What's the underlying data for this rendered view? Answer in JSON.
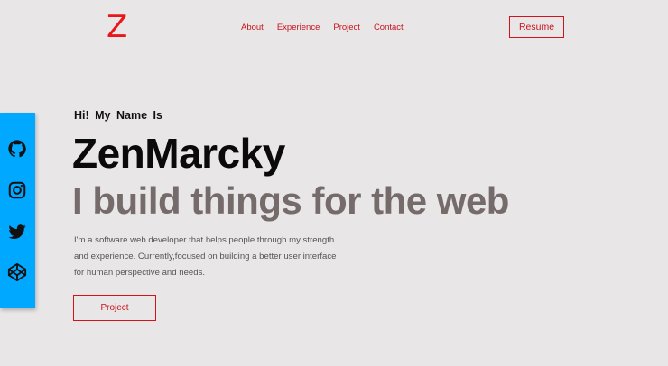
{
  "header": {
    "logo": "Z",
    "nav": [
      {
        "label": "About"
      },
      {
        "label": "Experience"
      },
      {
        "label": "Project"
      },
      {
        "label": "Contact"
      }
    ],
    "resume_label": "Resume"
  },
  "social": {
    "icons": [
      "github-icon",
      "instagram-icon",
      "twitter-icon",
      "codepen-icon"
    ]
  },
  "hero": {
    "greeting": "Hi! My Name Is",
    "name": "ZenMarcky",
    "tagline": "I build things for the web",
    "description": "I'm a software web developer that helps people through my strength and experience. Currently,focused on building a better user interface for human perspective and needs.",
    "button_label": "Project"
  },
  "colors": {
    "background": "#e8e6e6",
    "accent": "#d3131c",
    "sidebar": "#00a8ff",
    "tagline": "#756b6b"
  }
}
